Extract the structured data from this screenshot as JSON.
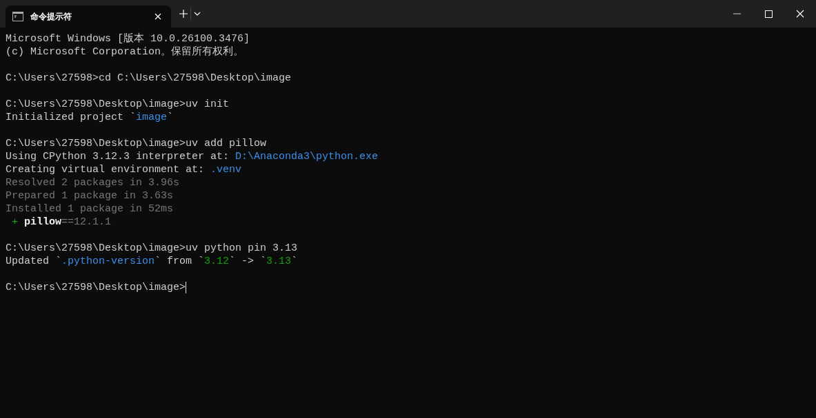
{
  "tabs": [
    {
      "title": "命令提示符",
      "selected": true
    }
  ],
  "terminal": {
    "lines": [
      {
        "kind": "text",
        "segments": [
          {
            "text": "Microsoft Windows [版本 10.0.26100.3476]",
            "kind": "output"
          }
        ]
      },
      {
        "kind": "text",
        "segments": [
          {
            "text": "(c) Microsoft Corporation。保留所有权利。",
            "kind": "output"
          }
        ]
      },
      {
        "kind": "blank"
      },
      {
        "kind": "text",
        "segments": [
          {
            "text": "C:\\Users\\27598>cd C:\\Users\\27598\\Desktop\\image",
            "kind": "output"
          }
        ]
      },
      {
        "kind": "blank"
      },
      {
        "kind": "text",
        "segments": [
          {
            "text": "C:\\Users\\27598\\Desktop\\image>uv init",
            "kind": "output"
          }
        ]
      },
      {
        "kind": "text",
        "segments": [
          {
            "text": "Initialized project `",
            "kind": "output"
          },
          {
            "text": "image",
            "kind": "path"
          },
          {
            "text": "`",
            "kind": "output"
          }
        ]
      },
      {
        "kind": "blank"
      },
      {
        "kind": "text",
        "segments": [
          {
            "text": "C:\\Users\\27598\\Desktop\\image>uv add pillow",
            "kind": "output"
          }
        ]
      },
      {
        "kind": "text",
        "segments": [
          {
            "text": "Using CPython 3.12.3 interpreter at: ",
            "kind": "output"
          },
          {
            "text": "D:\\Anaconda3\\python.exe",
            "kind": "path"
          }
        ]
      },
      {
        "kind": "text",
        "segments": [
          {
            "text": "Creating virtual environment at: ",
            "kind": "output"
          },
          {
            "text": ".venv",
            "kind": "path"
          }
        ]
      },
      {
        "kind": "text",
        "segments": [
          {
            "text": "Resolved 2 packages in 3.96s",
            "kind": "detail"
          }
        ]
      },
      {
        "kind": "text",
        "segments": [
          {
            "text": "Prepared 1 package in 3.63s",
            "kind": "detail"
          }
        ]
      },
      {
        "kind": "text",
        "segments": [
          {
            "text": "Installed 1 package in 52ms",
            "kind": "detail"
          }
        ]
      },
      {
        "kind": "text",
        "segments": [
          {
            "text": " + ",
            "kind": "added"
          },
          {
            "text": "pillow",
            "kind": "package"
          },
          {
            "text": "==12.1.1",
            "kind": "detail"
          }
        ]
      },
      {
        "kind": "blank"
      },
      {
        "kind": "text",
        "segments": [
          {
            "text": "C:\\Users\\27598\\Desktop\\image>uv python pin 3.13",
            "kind": "output"
          }
        ]
      },
      {
        "kind": "text",
        "segments": [
          {
            "text": "Updated `",
            "kind": "output"
          },
          {
            "text": ".python-version",
            "kind": "path"
          },
          {
            "text": "` from `",
            "kind": "output"
          },
          {
            "text": "3.12",
            "kind": "version"
          },
          {
            "text": "` -> `",
            "kind": "output"
          },
          {
            "text": "3.13",
            "kind": "version"
          },
          {
            "text": "`",
            "kind": "output"
          }
        ]
      },
      {
        "kind": "blank"
      },
      {
        "kind": "prompt",
        "segments": [
          {
            "text": "C:\\Users\\27598\\Desktop\\image>",
            "kind": "output"
          }
        ],
        "cursor": true
      }
    ]
  }
}
